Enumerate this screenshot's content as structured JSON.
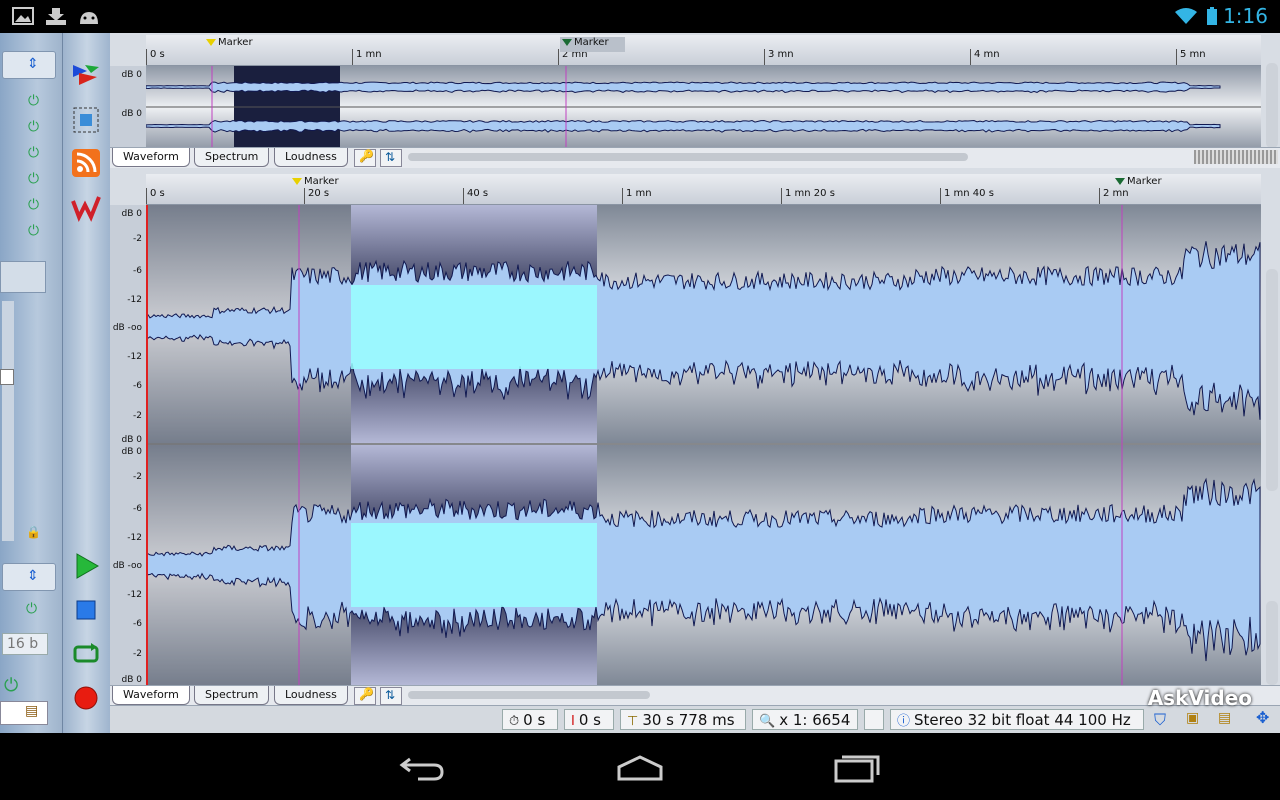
{
  "status": {
    "time": "1:16"
  },
  "overview": {
    "ruler_labels": [
      "0 s",
      "1 mn",
      "2 mn",
      "3 mn",
      "4 mn",
      "5 mn"
    ],
    "markers": [
      "Marker",
      "Marker"
    ],
    "db_labels": [
      "dB 0",
      "dB 0"
    ]
  },
  "detail": {
    "ruler_labels": [
      "0 s",
      "20 s",
      "40 s",
      "1 mn",
      "1 mn 20 s",
      "1 mn 40 s",
      "2 mn"
    ],
    "markers": [
      "Marker",
      "Marker"
    ],
    "db_top": [
      "dB 0",
      "-2",
      "-6",
      "-12",
      "dB -oo",
      "-12",
      "-6",
      "-2",
      "dB 0"
    ],
    "db_bottom": [
      "dB 0",
      "-2",
      "-6",
      "-12",
      "dB -oo",
      "-12",
      "-6",
      "-2",
      "dB 0"
    ]
  },
  "tabs": {
    "waveform": "Waveform",
    "spectrum": "Spectrum",
    "loudness": "Loudness"
  },
  "left_panel": {
    "bit_label": "16 b"
  },
  "bottom_bar": {
    "time_cursor": "0 s",
    "time_start": "0 s",
    "selection_length": "30 s 778 ms",
    "zoom": "x 1: 6654",
    "format": "Stereo 32 bit float 44 100 Hz"
  },
  "watermark": "AskVideo",
  "colors": {
    "accent": "#33b5e5",
    "wave_fill": "#a9cbf3",
    "wave_line": "#101850",
    "selection": "#99ffff"
  }
}
